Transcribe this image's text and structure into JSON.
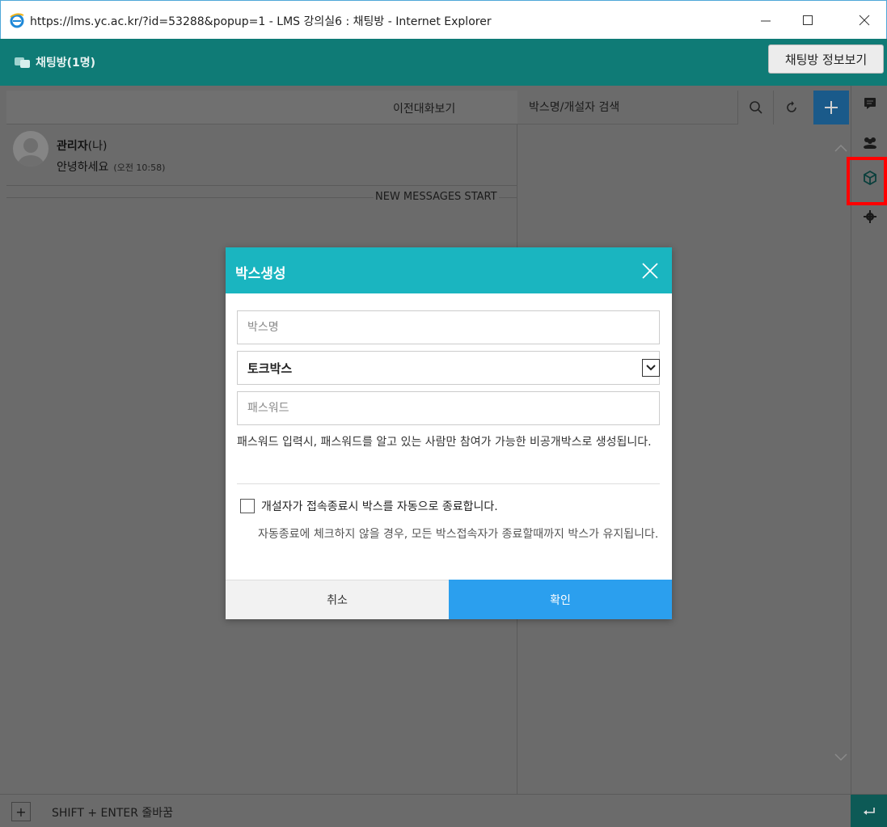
{
  "window": {
    "title": "https://lms.yc.ac.kr/?id=53288&popup=1 - LMS 강의실6 : 채팅방 - Internet Explorer"
  },
  "header": {
    "title": "채팅방(1명)",
    "info_button": "채팅방 정보보기"
  },
  "chat": {
    "history_label": "이전대화보기",
    "message": {
      "name": "관리자",
      "name_suffix": "(나)",
      "text": "안녕하세요",
      "time": "(오전 10:58)"
    },
    "new_messages_label": "NEW MESSAGES START"
  },
  "box_panel": {
    "search_placeholder": "박스명/개설자 검색"
  },
  "footer": {
    "hint": "SHIFT + ENTER 줄바꿈"
  },
  "modal": {
    "title": "박스생성",
    "name_placeholder": "박스명",
    "type_value": "토크박스",
    "password_placeholder": "패스워드",
    "password_note": "패스워드 입력시, 패스워드를 알고 있는 사람만 참여가 가능한 비공개박스로 생성됩니다.",
    "auto_close_label": "개설자가 접속종료시 박스를 자동으로 종료합니다.",
    "auto_close_note": "자동종료에 체크하지 않을 경우, 모든 박스접속자가 종료할때까지 박스가 유지됩니다.",
    "cancel_label": "취소",
    "ok_label": "확인"
  },
  "colors": {
    "header": "#0f7b76",
    "modal_header": "#1ab5c0",
    "ok_button": "#2b9fee",
    "highlight": "#ff0000"
  }
}
